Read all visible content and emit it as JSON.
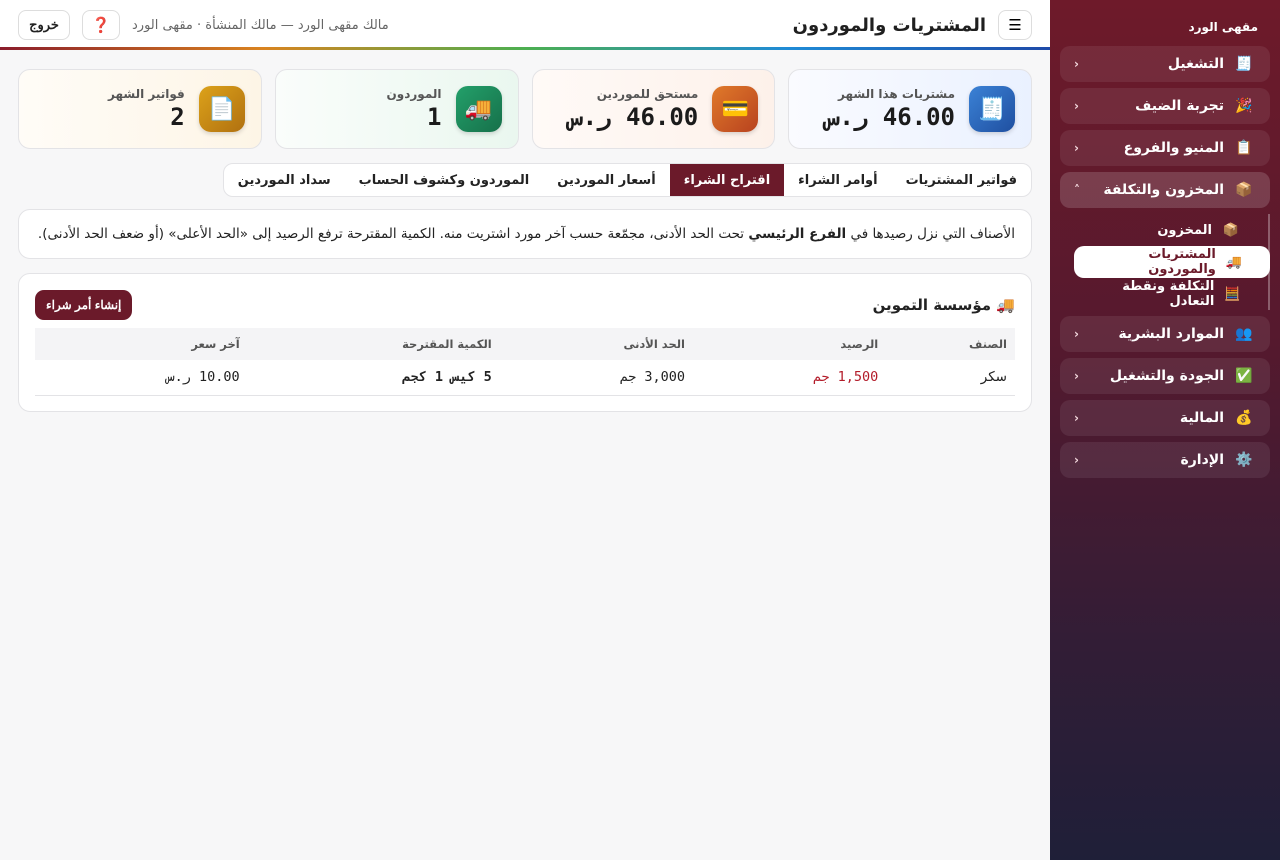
{
  "brand": "مقهى الورد",
  "sidebar": {
    "groups": [
      {
        "label": "التشغيل",
        "icon": "🧾"
      },
      {
        "label": "تجربة الضيف",
        "icon": "🎉"
      },
      {
        "label": "المنيو والفروع",
        "icon": "📋"
      },
      {
        "label": "المخزون والتكلفة",
        "icon": "📦"
      },
      {
        "label": "الموارد البشرية",
        "icon": "👥"
      },
      {
        "label": "الجودة والتشغيل",
        "icon": "✅"
      },
      {
        "label": "المالية",
        "icon": "💰"
      },
      {
        "label": "الإدارة",
        "icon": "⚙️"
      }
    ],
    "chevron_closed": "‹",
    "chevron_open": "˄",
    "subitems": [
      {
        "label": "المخزون",
        "icon": "📦"
      },
      {
        "label": "المشتريات والموردون",
        "icon": "🚚"
      },
      {
        "label": "التكلفة ونقطة التعادل",
        "icon": "🧮"
      }
    ]
  },
  "header": {
    "menu_icon": "☰",
    "title": "المشتريات والموردون",
    "owner": "مالك مقهى الورد — مالك المنشأة · مقهى الورد",
    "help_icon": "❓",
    "logout": "خروج"
  },
  "stats": [
    {
      "label": "مشتريات هذا الشهر",
      "value": "46.00 ر.س",
      "icon": "🧾"
    },
    {
      "label": "مستحق للموردين",
      "value": "46.00 ر.س",
      "icon": "💳"
    },
    {
      "label": "الموردون",
      "value": "1",
      "icon": "🚚"
    },
    {
      "label": "فواتير الشهر",
      "value": "2",
      "icon": "📄"
    }
  ],
  "tabs": [
    "فواتير المشتريات",
    "أوامر الشراء",
    "اقتراح الشراء",
    "أسعار الموردين",
    "الموردون وكشوف الحساب",
    "سداد الموردين"
  ],
  "active_tab": "اقتراح الشراء",
  "info": {
    "part1": "الأصناف التي نزل رصيدها في ",
    "bold": "الفرع الرئيسي",
    "part2": " تحت الحد الأدنى، مجمّعة حسب آخر مورد اشتريت منه. الكمية المقترحة ترفع الرصيد إلى «الحد الأعلى» (أو ضعف الحد الأدنى)."
  },
  "supplier_card": {
    "icon": "🚚",
    "name": "مؤسسة التموين",
    "create_button": "إنشاء أمر شراء",
    "columns": [
      "الصنف",
      "الرصيد",
      "الحد الأدنى",
      "الكمية المقترحة",
      "آخر سعر"
    ],
    "rows": [
      {
        "item": "سكر",
        "balance": "1,500 جم",
        "min": "3,000 جم",
        "suggested": "5 كيس 1 كجم",
        "last_price": "10.00 ر.س"
      }
    ]
  },
  "colors": {
    "accent": "#6b1a2a",
    "danger_text": "#b31c2a"
  }
}
